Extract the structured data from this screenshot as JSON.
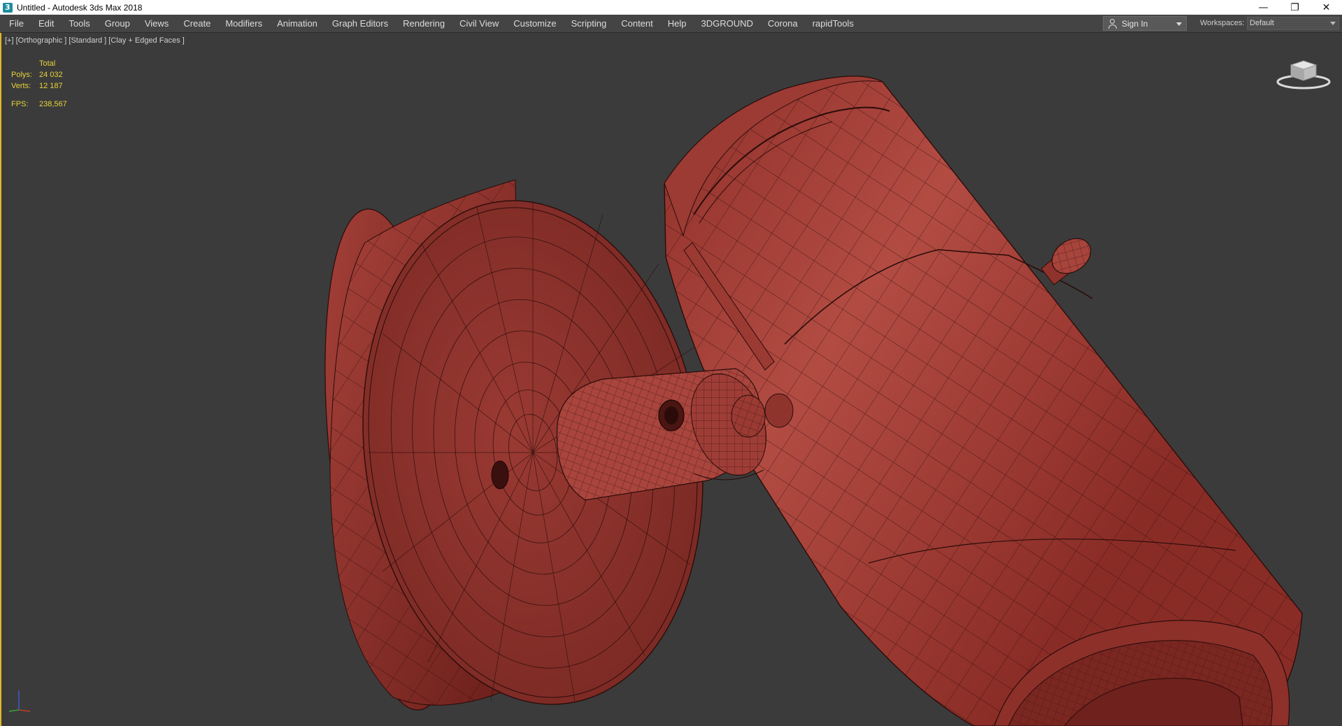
{
  "window": {
    "title": "Untitled - Autodesk 3ds Max 2018",
    "controls": {
      "minimize": "—",
      "restore": "❐",
      "close": "✕"
    }
  },
  "menu": {
    "items": [
      "File",
      "Edit",
      "Tools",
      "Group",
      "Views",
      "Create",
      "Modifiers",
      "Animation",
      "Graph Editors",
      "Rendering",
      "Civil View",
      "Customize",
      "Scripting",
      "Content",
      "Help",
      "3DGROUND",
      "Corona",
      "rapidTools"
    ]
  },
  "account": {
    "sign_in": "Sign In"
  },
  "workspaces": {
    "label": "Workspaces:",
    "value": "Default"
  },
  "viewport": {
    "label": "[+] [Orthographic ] [Standard ] [Clay + Edged Faces ]",
    "stats": {
      "header": "Total",
      "polys_label": "Polys:",
      "polys_value": "24 032",
      "verts_label": "Verts:",
      "verts_value": "12 187",
      "fps_label": "FPS:",
      "fps_value": "238,567"
    },
    "accent_color": "#e1b72a",
    "model_color": "#a8423a"
  }
}
